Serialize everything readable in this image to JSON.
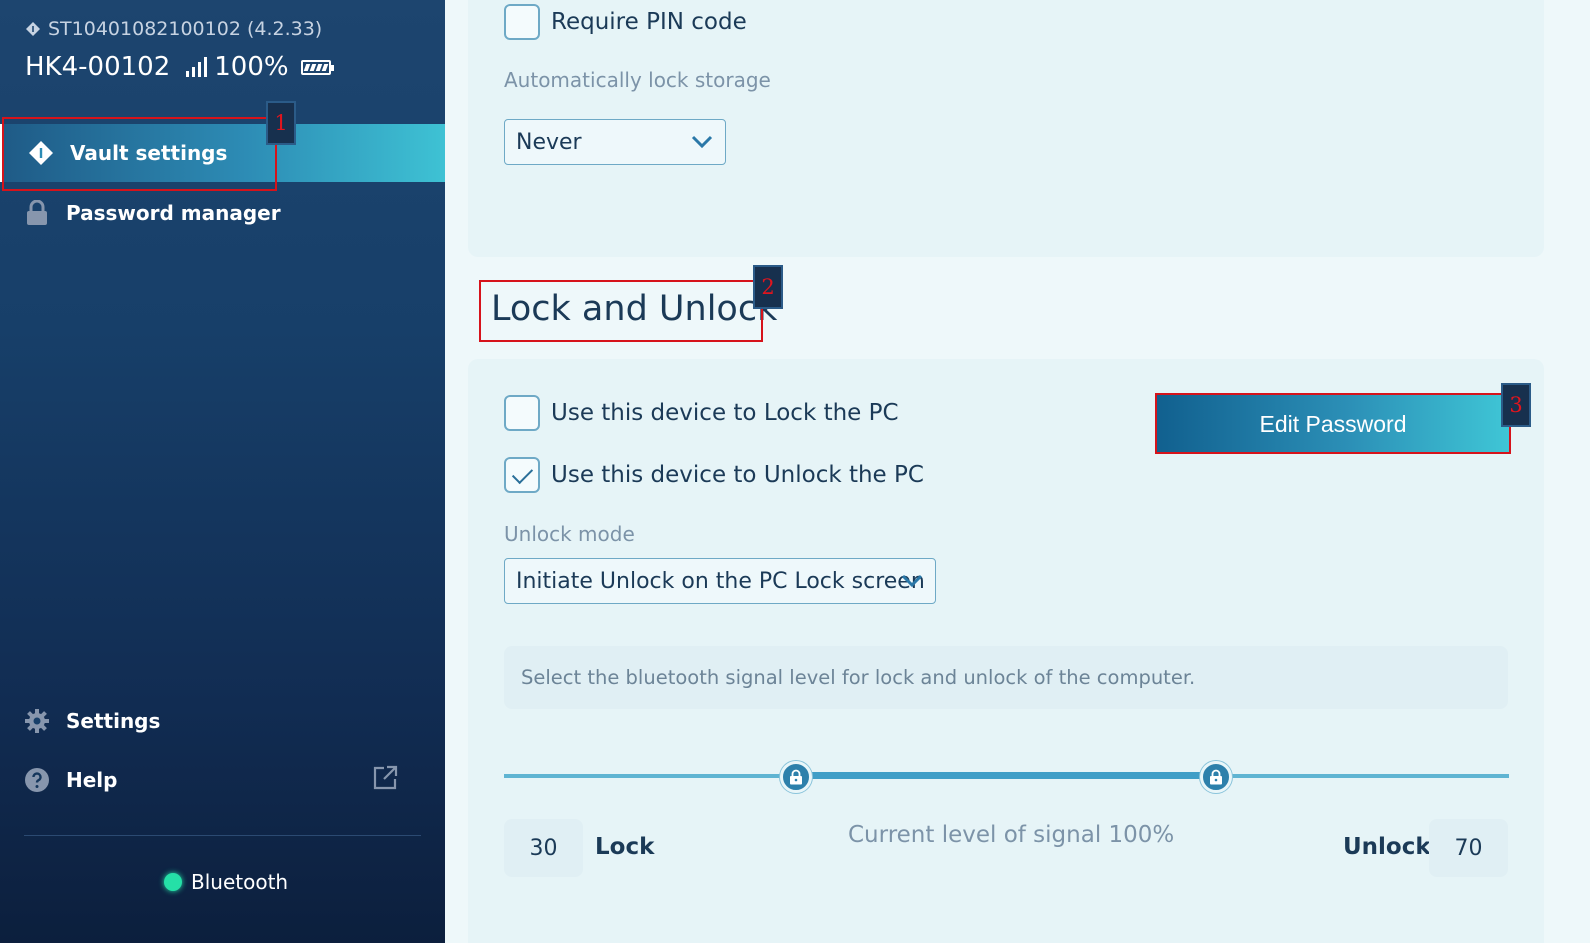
{
  "device": {
    "id_text": "ST10401082100102 (4.2.33)",
    "name": "HK4-00102",
    "battery_pct": "100%"
  },
  "sidebar": {
    "items": [
      {
        "label": "Vault settings",
        "icon": "vault-diamond-icon",
        "active": true
      },
      {
        "label": "Password manager",
        "icon": "lock-icon"
      },
      {
        "label": "Settings",
        "icon": "gear-icon"
      },
      {
        "label": "Help",
        "icon": "help-icon"
      }
    ],
    "connection_label": "Bluetooth",
    "connection_color": "#25e0a7"
  },
  "storage": {
    "require_pin_label": "Require PIN code",
    "require_pin_checked": false,
    "auto_lock_label": "Automatically lock storage",
    "auto_lock_value": "Never"
  },
  "lock_unlock": {
    "title": "Lock and Unlock",
    "lock_pc_label": "Use this device to Lock the PC",
    "lock_pc_checked": false,
    "unlock_pc_label": "Use this device to Unlock the PC",
    "unlock_pc_checked": true,
    "edit_password_label": "Edit Password",
    "unlock_mode_label": "Unlock mode",
    "unlock_mode_value": "Initiate Unlock on the PC Lock screen",
    "signal_info": "Select the bluetooth signal level for lock and unlock of the computer.",
    "lock_value": "30",
    "lock_label": "Lock",
    "unlock_value": "70",
    "unlock_label": "Unlock",
    "current_signal_text": "Current level of signal 100%"
  },
  "annotations": [
    "1",
    "2",
    "3"
  ],
  "colors": {
    "accent": "#2d8cb5",
    "sidebar_bg": "#173f69",
    "annotation": "#d6131b"
  }
}
